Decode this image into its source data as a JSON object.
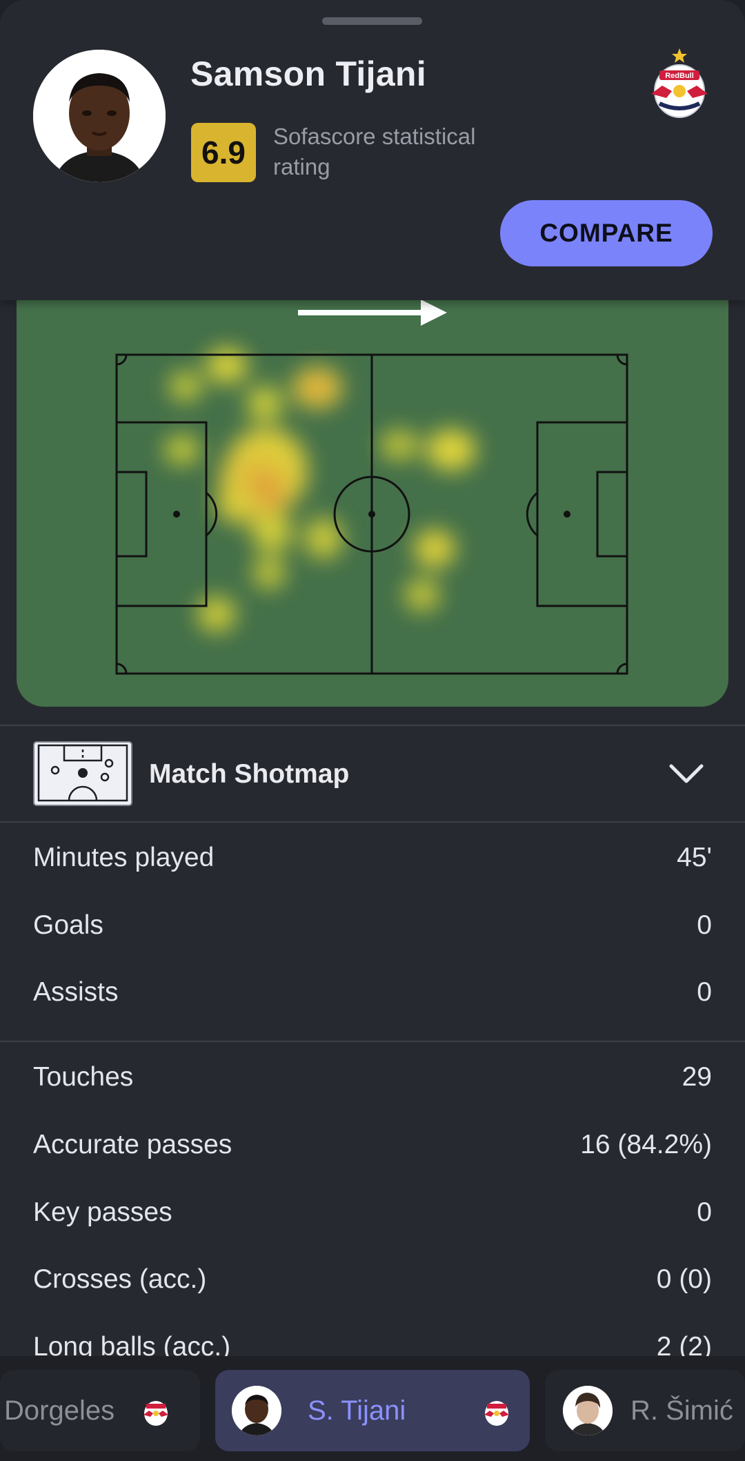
{
  "player": {
    "name": "Samson Tijani",
    "rating": "6.9",
    "rating_label": "Sofascore statistical rating",
    "club_logo": "Red Bull Salzburg crest"
  },
  "actions": {
    "compare_label": "COMPARE"
  },
  "heatmap": {
    "direction_icon": "arrow-right-icon",
    "pitch_color": "#44704a"
  },
  "shotmap": {
    "title": "Match Shotmap",
    "expand_icon": "chevron-down-icon"
  },
  "stats_group_1": [
    {
      "label": "Minutes played",
      "value": "45'"
    },
    {
      "label": "Goals",
      "value": "0"
    },
    {
      "label": "Assists",
      "value": "0"
    }
  ],
  "stats_group_2": [
    {
      "label": "Touches",
      "value": "29"
    },
    {
      "label": "Accurate passes",
      "value": "16 (84.2%)"
    },
    {
      "label": "Key passes",
      "value": "0"
    },
    {
      "label": "Crosses (acc.)",
      "value": "0 (0)"
    },
    {
      "label": "Long balls (acc.)",
      "value": "2 (2)"
    }
  ],
  "player_switcher": [
    {
      "name": "Dorgeles",
      "active": false
    },
    {
      "name": "S. Tijani",
      "active": true
    },
    {
      "name": "R. Šimić",
      "active": false
    }
  ],
  "colors": {
    "accent": "#7b83fb",
    "rating": "#d9b42e",
    "background": "#272930"
  }
}
